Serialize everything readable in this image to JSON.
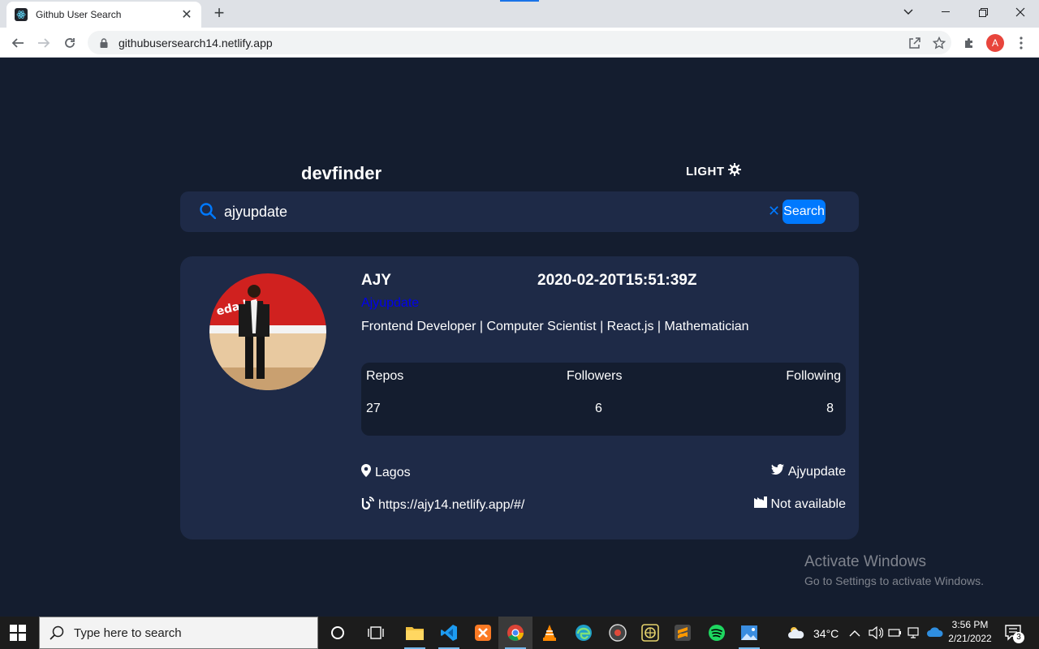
{
  "browser": {
    "tab_title": "Github User Search",
    "url": "githubusersearch14.netlify.app",
    "profile_initial": "A"
  },
  "app": {
    "logo": "devfinder",
    "theme_toggle": "LIGHT",
    "search": {
      "value": "ajyupdate",
      "clear_glyph": "✕",
      "button": "Search"
    },
    "profile": {
      "name": "AJY",
      "joined": "2020-02-20T15:51:39Z",
      "login": "Ajyupdate",
      "bio": "Frontend Developer | Computer Scientist | React.js | Mathematician",
      "stats": {
        "repos_label": "Repos",
        "followers_label": "Followers",
        "following_label": "Following",
        "repos": "27",
        "followers": "6",
        "following": "8"
      },
      "location": "Lagos",
      "twitter": "Ajyupdate",
      "blog": "https://ajy14.netlify.app/#/",
      "company": "Not available"
    }
  },
  "watermark": {
    "line1": "Activate Windows",
    "line2": "Go to Settings to activate Windows."
  },
  "taskbar": {
    "search_placeholder": "Type here to search",
    "weather": "34°C",
    "time": "3:56 PM",
    "date": "2/21/2022",
    "notifications": "3"
  },
  "colors": {
    "background": "#141d2f",
    "card": "#1e2a47",
    "accent": "#0079ff"
  }
}
